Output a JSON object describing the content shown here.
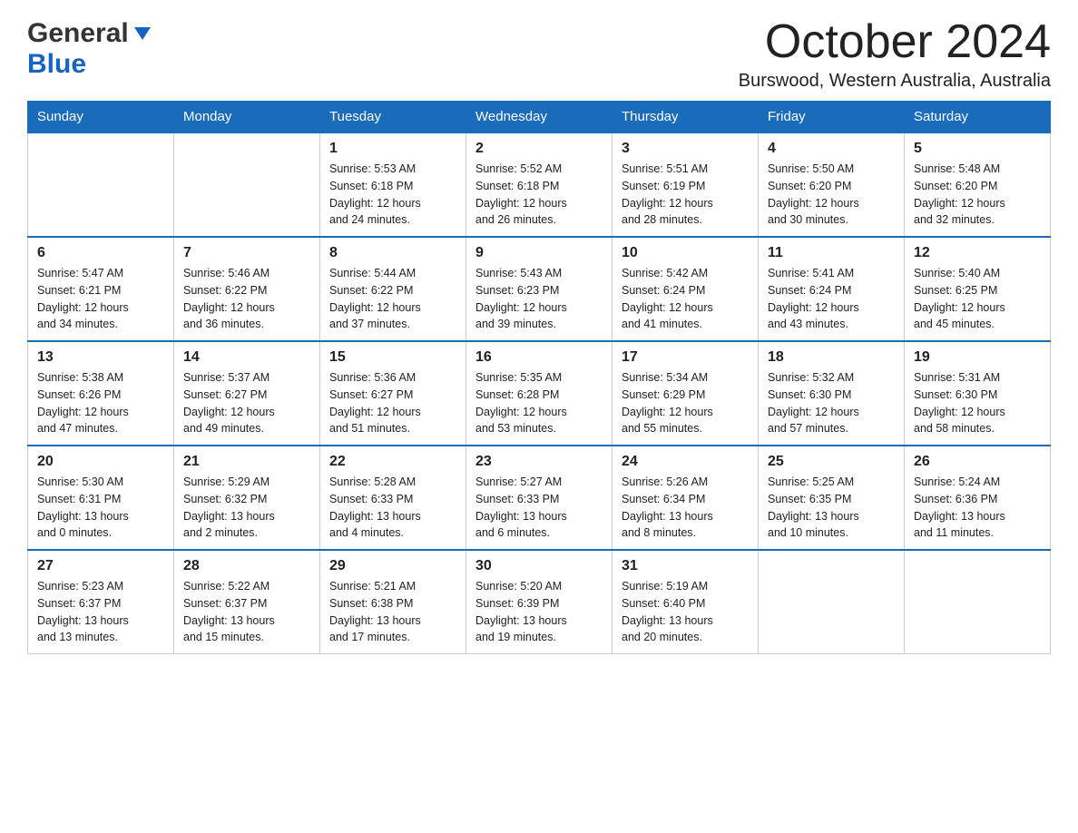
{
  "header": {
    "logo_general": "General",
    "logo_blue": "Blue",
    "month_title": "October 2024",
    "location": "Burswood, Western Australia, Australia"
  },
  "weekdays": [
    "Sunday",
    "Monday",
    "Tuesday",
    "Wednesday",
    "Thursday",
    "Friday",
    "Saturday"
  ],
  "weeks": [
    [
      {
        "day": "",
        "info": ""
      },
      {
        "day": "",
        "info": ""
      },
      {
        "day": "1",
        "info": "Sunrise: 5:53 AM\nSunset: 6:18 PM\nDaylight: 12 hours\nand 24 minutes."
      },
      {
        "day": "2",
        "info": "Sunrise: 5:52 AM\nSunset: 6:18 PM\nDaylight: 12 hours\nand 26 minutes."
      },
      {
        "day": "3",
        "info": "Sunrise: 5:51 AM\nSunset: 6:19 PM\nDaylight: 12 hours\nand 28 minutes."
      },
      {
        "day": "4",
        "info": "Sunrise: 5:50 AM\nSunset: 6:20 PM\nDaylight: 12 hours\nand 30 minutes."
      },
      {
        "day": "5",
        "info": "Sunrise: 5:48 AM\nSunset: 6:20 PM\nDaylight: 12 hours\nand 32 minutes."
      }
    ],
    [
      {
        "day": "6",
        "info": "Sunrise: 5:47 AM\nSunset: 6:21 PM\nDaylight: 12 hours\nand 34 minutes."
      },
      {
        "day": "7",
        "info": "Sunrise: 5:46 AM\nSunset: 6:22 PM\nDaylight: 12 hours\nand 36 minutes."
      },
      {
        "day": "8",
        "info": "Sunrise: 5:44 AM\nSunset: 6:22 PM\nDaylight: 12 hours\nand 37 minutes."
      },
      {
        "day": "9",
        "info": "Sunrise: 5:43 AM\nSunset: 6:23 PM\nDaylight: 12 hours\nand 39 minutes."
      },
      {
        "day": "10",
        "info": "Sunrise: 5:42 AM\nSunset: 6:24 PM\nDaylight: 12 hours\nand 41 minutes."
      },
      {
        "day": "11",
        "info": "Sunrise: 5:41 AM\nSunset: 6:24 PM\nDaylight: 12 hours\nand 43 minutes."
      },
      {
        "day": "12",
        "info": "Sunrise: 5:40 AM\nSunset: 6:25 PM\nDaylight: 12 hours\nand 45 minutes."
      }
    ],
    [
      {
        "day": "13",
        "info": "Sunrise: 5:38 AM\nSunset: 6:26 PM\nDaylight: 12 hours\nand 47 minutes."
      },
      {
        "day": "14",
        "info": "Sunrise: 5:37 AM\nSunset: 6:27 PM\nDaylight: 12 hours\nand 49 minutes."
      },
      {
        "day": "15",
        "info": "Sunrise: 5:36 AM\nSunset: 6:27 PM\nDaylight: 12 hours\nand 51 minutes."
      },
      {
        "day": "16",
        "info": "Sunrise: 5:35 AM\nSunset: 6:28 PM\nDaylight: 12 hours\nand 53 minutes."
      },
      {
        "day": "17",
        "info": "Sunrise: 5:34 AM\nSunset: 6:29 PM\nDaylight: 12 hours\nand 55 minutes."
      },
      {
        "day": "18",
        "info": "Sunrise: 5:32 AM\nSunset: 6:30 PM\nDaylight: 12 hours\nand 57 minutes."
      },
      {
        "day": "19",
        "info": "Sunrise: 5:31 AM\nSunset: 6:30 PM\nDaylight: 12 hours\nand 58 minutes."
      }
    ],
    [
      {
        "day": "20",
        "info": "Sunrise: 5:30 AM\nSunset: 6:31 PM\nDaylight: 13 hours\nand 0 minutes."
      },
      {
        "day": "21",
        "info": "Sunrise: 5:29 AM\nSunset: 6:32 PM\nDaylight: 13 hours\nand 2 minutes."
      },
      {
        "day": "22",
        "info": "Sunrise: 5:28 AM\nSunset: 6:33 PM\nDaylight: 13 hours\nand 4 minutes."
      },
      {
        "day": "23",
        "info": "Sunrise: 5:27 AM\nSunset: 6:33 PM\nDaylight: 13 hours\nand 6 minutes."
      },
      {
        "day": "24",
        "info": "Sunrise: 5:26 AM\nSunset: 6:34 PM\nDaylight: 13 hours\nand 8 minutes."
      },
      {
        "day": "25",
        "info": "Sunrise: 5:25 AM\nSunset: 6:35 PM\nDaylight: 13 hours\nand 10 minutes."
      },
      {
        "day": "26",
        "info": "Sunrise: 5:24 AM\nSunset: 6:36 PM\nDaylight: 13 hours\nand 11 minutes."
      }
    ],
    [
      {
        "day": "27",
        "info": "Sunrise: 5:23 AM\nSunset: 6:37 PM\nDaylight: 13 hours\nand 13 minutes."
      },
      {
        "day": "28",
        "info": "Sunrise: 5:22 AM\nSunset: 6:37 PM\nDaylight: 13 hours\nand 15 minutes."
      },
      {
        "day": "29",
        "info": "Sunrise: 5:21 AM\nSunset: 6:38 PM\nDaylight: 13 hours\nand 17 minutes."
      },
      {
        "day": "30",
        "info": "Sunrise: 5:20 AM\nSunset: 6:39 PM\nDaylight: 13 hours\nand 19 minutes."
      },
      {
        "day": "31",
        "info": "Sunrise: 5:19 AM\nSunset: 6:40 PM\nDaylight: 13 hours\nand 20 minutes."
      },
      {
        "day": "",
        "info": ""
      },
      {
        "day": "",
        "info": ""
      }
    ]
  ]
}
